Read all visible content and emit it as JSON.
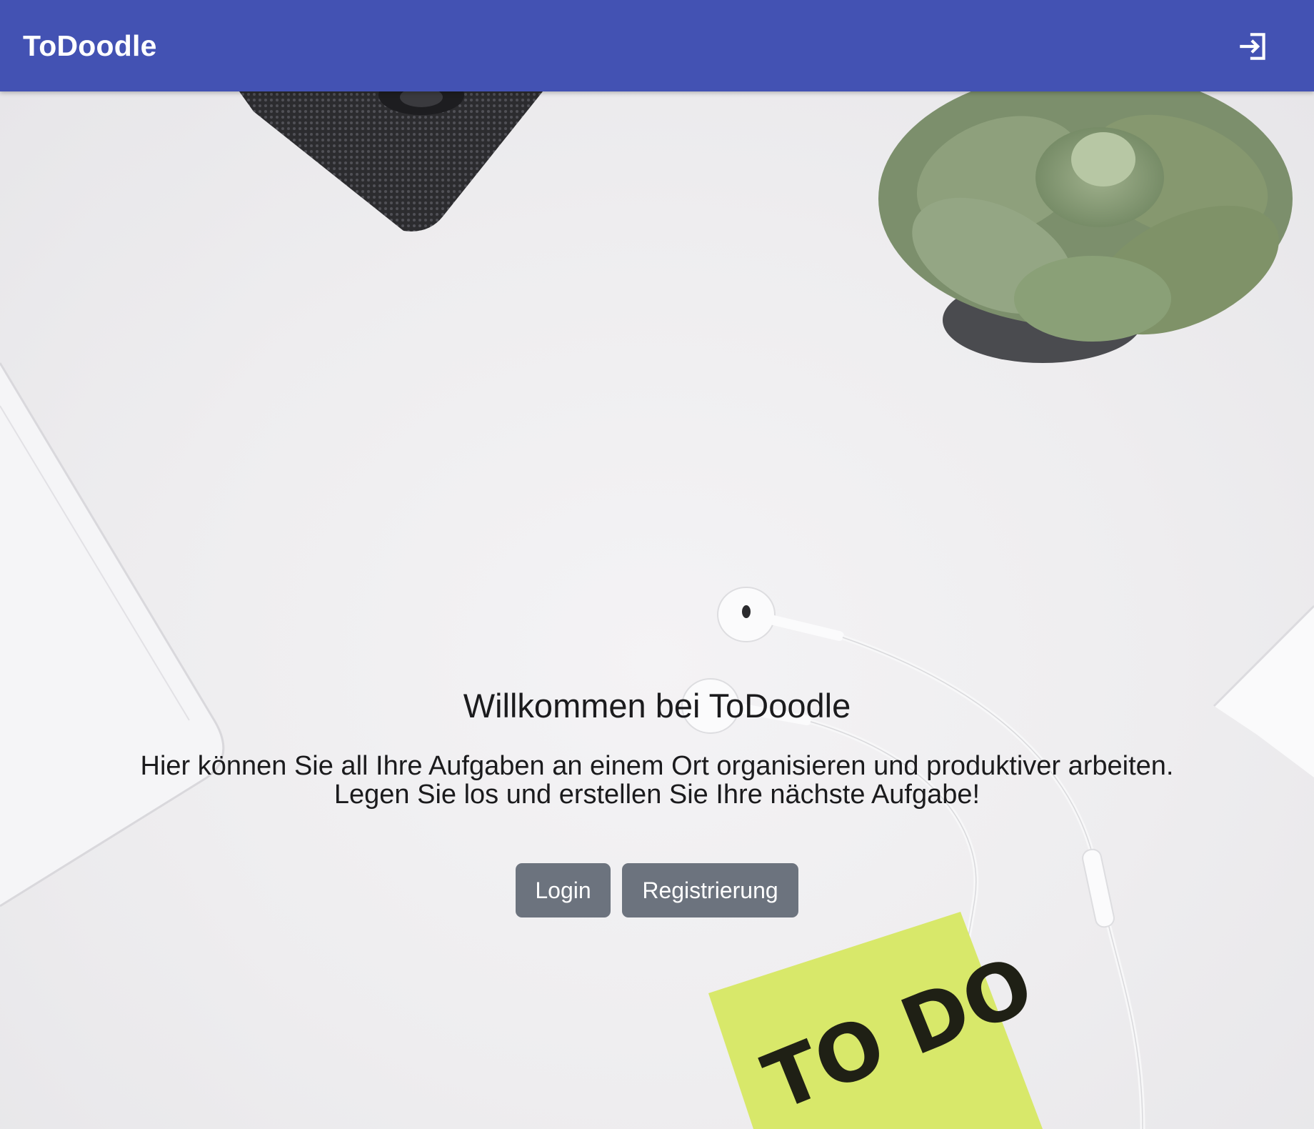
{
  "app": {
    "title": "ToDoodle"
  },
  "header": {
    "login_icon": "login-arrow-icon"
  },
  "hero": {
    "headline": "Willkommen bei ToDoodle",
    "intro_line1": "Hier können Sie all Ihre Aufgaben an einem Ort organisieren und produktiver arbeiten.",
    "intro_line2": "Legen Sie los und erstellen Sie Ihre nächste Aufgabe!",
    "sticky_note": "TO DO"
  },
  "actions": {
    "login_label": "Login",
    "register_label": "Registrierung"
  },
  "colors": {
    "app_bar": "#4352b3",
    "button": "#6c737e",
    "background": "#eeedef",
    "sticky_note": "#d8e86a"
  }
}
